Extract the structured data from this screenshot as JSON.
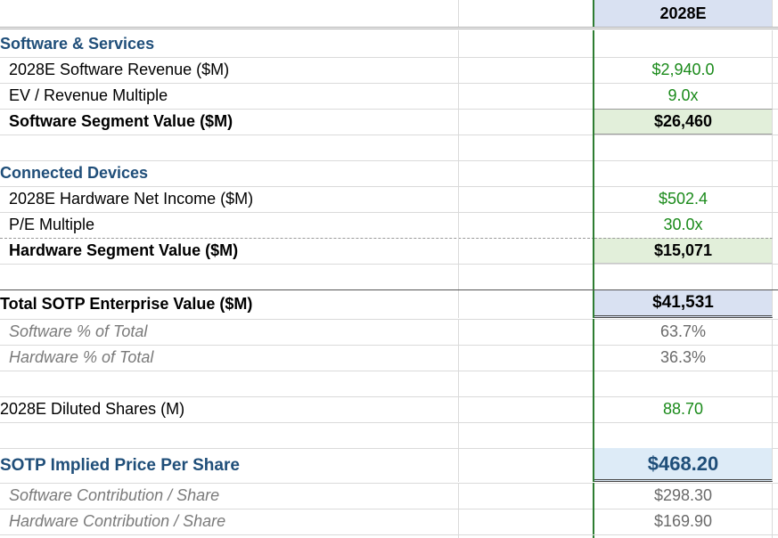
{
  "header": {
    "col_label": "2028E"
  },
  "software": {
    "section_label": "Software & Services",
    "revenue_label": "2028E Software Revenue ($M)",
    "revenue_value": "$2,940.0",
    "multiple_label": "EV / Revenue Multiple",
    "multiple_value": "9.0x",
    "segment_label": "Software Segment Value ($M)",
    "segment_value": "$26,460"
  },
  "devices": {
    "section_label": "Connected Devices",
    "income_label": "2028E Hardware Net Income ($M)",
    "income_value": "$502.4",
    "pe_label": "P/E Multiple",
    "pe_value": "30.0x",
    "segment_label": "Hardware Segment Value ($M)",
    "segment_value": "$15,071"
  },
  "total": {
    "label": "Total SOTP Enterprise Value ($M)",
    "value": "$41,531",
    "sw_pct_label": "Software % of Total",
    "sw_pct_value": "63.7%",
    "hw_pct_label": "Hardware % of Total",
    "hw_pct_value": "36.3%"
  },
  "shares": {
    "label": "2028E Diluted Shares (M)",
    "value": "88.70"
  },
  "price": {
    "label": "SOTP Implied Price Per Share",
    "value": "$468.20",
    "sw_contrib_label": "Software Contribution / Share",
    "sw_contrib_value": "$298.30",
    "hw_contrib_label": "Hardware Contribution / Share",
    "hw_contrib_value": "$169.90"
  },
  "colors": {
    "accent_blue": "#1f4e79",
    "input_green": "#1a8a1a",
    "header_fill": "#d9e1f2",
    "segment_fill": "#e2efda",
    "price_fill": "#ddebf7",
    "column_border": "#2e7d32"
  }
}
